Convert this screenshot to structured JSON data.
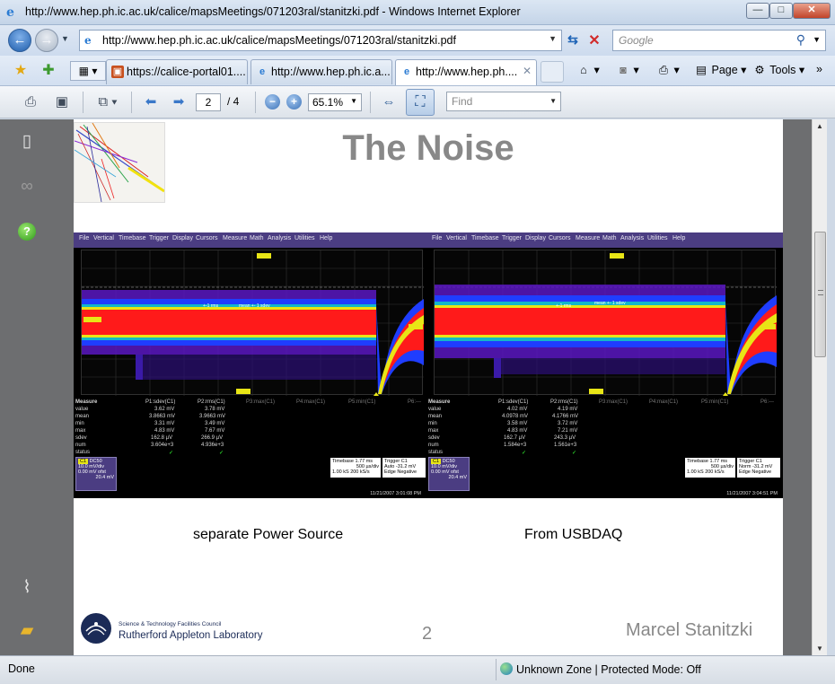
{
  "window": {
    "title": "http://www.hep.ph.ic.ac.uk/calice/mapsMeetings/071203ral/stanitzki.pdf - Windows Internet Explorer",
    "min_label": "—",
    "max_label": "□",
    "close_label": "✕"
  },
  "address_bar": {
    "url": "http://www.hep.ph.ic.ac.uk/calice/mapsMeetings/071203ral/stanitzki.pdf",
    "search_placeholder": "Google"
  },
  "tabs": [
    {
      "label": "https://calice-portal01....",
      "active": false
    },
    {
      "label": "http://www.hep.ph.ic.a...",
      "active": false
    },
    {
      "label": "http://www.hep.ph....",
      "active": true
    }
  ],
  "command_bar": {
    "page_label": "Page",
    "tools_label": "Tools",
    "overflow": "»"
  },
  "pdf_toolbar": {
    "current_page": "2",
    "total_pages": "/ 4",
    "zoom": "65.1%",
    "find_placeholder": "Find"
  },
  "slide": {
    "title": "The Noise",
    "caption_left": "separate Power Source",
    "caption_right": "From USBDAQ",
    "page_number": "2",
    "author": "Marcel Stanitzki",
    "lab_line1": "Science & Technology Facilities Council",
    "lab_line2": "Rutherford Appleton Laboratory"
  },
  "scope_menu": [
    "File",
    "Vertical",
    "Timebase",
    "Trigger",
    "Display",
    "Cursors",
    "Measure",
    "Math",
    "Analysis",
    "Utilities",
    "Help"
  ],
  "scopes": {
    "left": {
      "header": [
        "Measure",
        "P1:sdev(C1)",
        "P2:rms(C1)",
        "P3:max(C1)",
        "P4:max(C1)",
        "P5:min(C1)",
        "P6:---"
      ],
      "rows": [
        [
          "value",
          "3.62 mV",
          "3.78 mV"
        ],
        [
          "mean",
          "3.8663 mV",
          "3.9663 mV"
        ],
        [
          "min",
          "3.31 mV",
          "3.49 mV"
        ],
        [
          "max",
          "4.83 mV",
          "7.67 mV"
        ],
        [
          "sdev",
          "162.8 µV",
          "266.9 µV"
        ],
        [
          "num",
          "3.604e+3",
          "4.936e+3"
        ],
        [
          "status",
          "✓",
          "✓"
        ]
      ],
      "channel": [
        "C1",
        "DC50",
        "10.0 mV/div",
        "0.00 mV ofst",
        "20.4 mV"
      ],
      "timebase": [
        "Timebase",
        "1.77 ms",
        "500 µs/div",
        "1.00 kS",
        "200 kS/s"
      ],
      "trigger": [
        "Trigger",
        "C1",
        "Auto",
        "-31.2 mV",
        "Edge",
        "Negative"
      ],
      "stamp": "11/21/2007 3:01:08 PM"
    },
    "right": {
      "header": [
        "Measure",
        "P1:sdev(C1)",
        "P2:rms(C1)",
        "P3:max(C1)",
        "P4:max(C1)",
        "P5:min(C1)",
        "P6:---"
      ],
      "rows": [
        [
          "value",
          "4.02 mV",
          "4.19 mV"
        ],
        [
          "mean",
          "4.0978 mV",
          "4.1766 mV"
        ],
        [
          "min",
          "3.58 mV",
          "3.72 mV"
        ],
        [
          "max",
          "4.83 mV",
          "7.21 mV"
        ],
        [
          "sdev",
          "162.7 µV",
          "243.3 µV"
        ],
        [
          "num",
          "1.584e+3",
          "1.561e+3"
        ],
        [
          "status",
          "✓",
          "✓"
        ]
      ],
      "channel": [
        "C1",
        "DC50",
        "10.0 mV/div",
        "0.00 mV ofst",
        "20.4 mV"
      ],
      "timebase": [
        "Timebase",
        "1.77 ms",
        "500 µs/div",
        "1.00 kS",
        "200 kS/s"
      ],
      "trigger": [
        "Trigger",
        "C1",
        "Norm",
        "-31.2 mV",
        "Edge",
        "Negative"
      ],
      "stamp": "11/21/2007 3:04:51 PM"
    }
  },
  "status_bar": {
    "text": "Done",
    "zone": "Unknown Zone | Protected Mode: Off"
  },
  "colors": {
    "scope_menu": "#4b3d82",
    "trace_red": "#ff1a1a",
    "trace_blue": "#1e2fff",
    "trace_purple": "#7a2dd6"
  }
}
